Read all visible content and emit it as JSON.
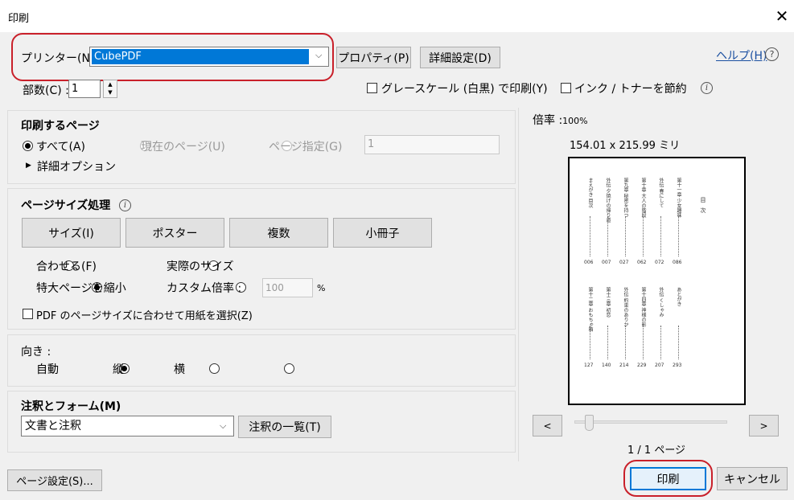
{
  "window": {
    "title": "印刷",
    "close_glyph": "✕"
  },
  "printer": {
    "label": "プリンター(N) :",
    "value": "CubePDF",
    "properties": "プロパティ(P)",
    "advanced": "詳細設定(D)"
  },
  "help": {
    "label": "ヘルプ(H)",
    "icon": "?"
  },
  "copies": {
    "label": "部数(C) :",
    "value": "1"
  },
  "grayscale": {
    "label": "グレースケール (白黒) で印刷(Y)",
    "checked": false
  },
  "save_ink": {
    "label": "インク / トナーを節約",
    "checked": false
  },
  "pages": {
    "heading": "印刷するページ",
    "all": "すべて(A)",
    "current": "現在のページ(U)",
    "range": "ページ指定(G)",
    "range_value": "1",
    "more_options": "詳細オプション"
  },
  "sizing": {
    "heading": "ページサイズ処理",
    "buttons": [
      "サイズ(I)",
      "ポスター",
      "複数",
      "小冊子"
    ],
    "fit": "合わせる(F)",
    "actual": "実際のサイズ",
    "shrink": "特大ページを縮小",
    "custom": "カスタム倍率 :",
    "custom_value": "100",
    "percent": "%",
    "pdf_paper": "PDF のページサイズに合わせて用紙を選択(Z)"
  },
  "orientation": {
    "heading": "向き :",
    "auto": "自動",
    "portrait": "縦",
    "landscape": "横"
  },
  "comments": {
    "heading": "注釈とフォーム(M)",
    "value": "文書と注釈",
    "summary": "注釈の一覧(T)"
  },
  "preview": {
    "scale_label": "倍率 :",
    "scale_value": "100%",
    "dimensions": "154.01 x 215.99 ミリ",
    "prev": "<",
    "next": ">",
    "page_indicator": "1 / 1 ページ",
    "slider_fraction": 0.0,
    "toc_title": "目次",
    "top_columns": [
      "第十一章 少女趣味",
      "外伝 春にして",
      "第十章 大人の階段",
      "第九章 秘密を持つ",
      "外伝 夕焼けの帰り道",
      "まえがき 目次"
    ],
    "top_numbers": [
      "086",
      "072",
      "062",
      "027",
      "007",
      "006"
    ],
    "bottom_columns": [
      "あとがき",
      "外伝 くしゃみ",
      "第十四章 神様の影",
      "外伝 約束のありか",
      "第十三章 初恋",
      "第十二章 おもちゃ箱"
    ],
    "bottom_numbers": [
      "293",
      "207",
      "229",
      "214",
      "140",
      "127"
    ]
  },
  "footer": {
    "page_setup": "ページ設定(S)...",
    "print": "印刷",
    "cancel": "キャンセル"
  },
  "colors": {
    "accent": "#0078d7",
    "highlight": "#c9202a",
    "link": "#1a4fa0"
  }
}
